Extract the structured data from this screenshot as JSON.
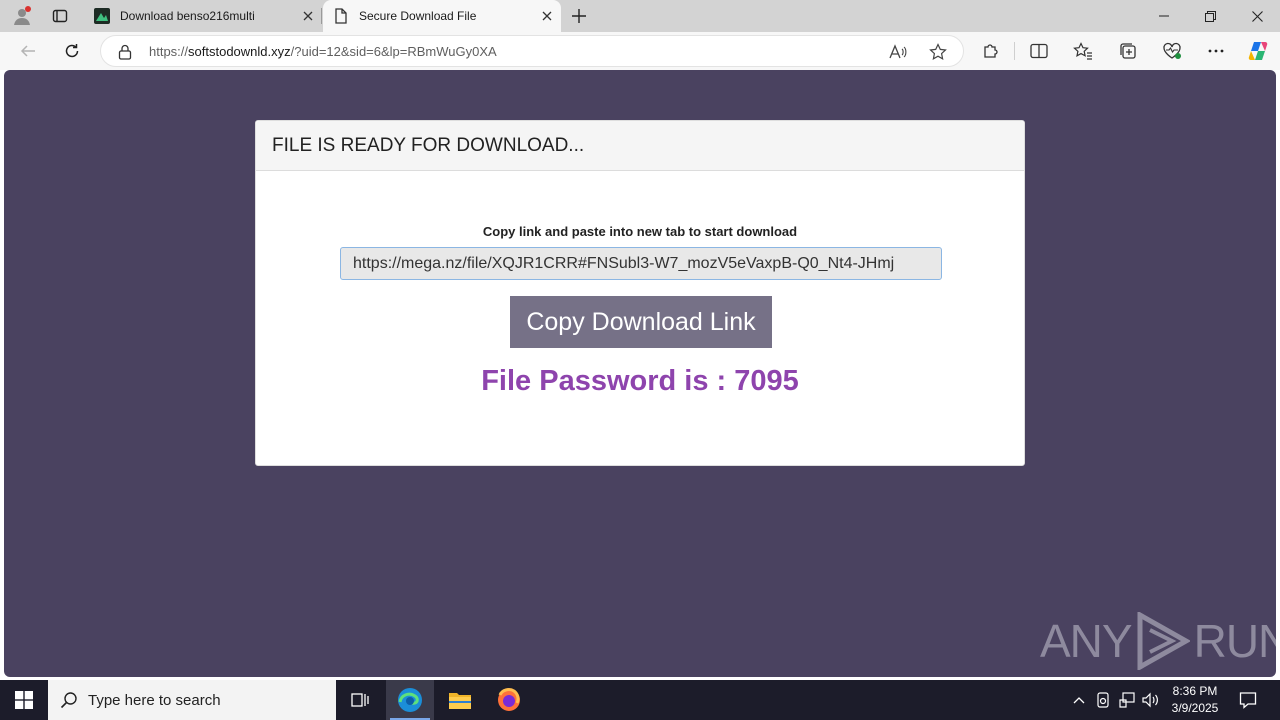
{
  "browser": {
    "tabs": [
      {
        "label": "Download benso216multi"
      },
      {
        "label": "Secure Download File"
      }
    ],
    "address": {
      "host": "softstodownld.xyz",
      "prefix": "https://",
      "path": "/?uid=12&sid=6&lp=RBmWuGy0XA"
    }
  },
  "page": {
    "card_title": "FILE IS READY FOR DOWNLOAD...",
    "instruction": "Copy link and paste into new tab to start download",
    "download_link": "https://mega.nz/file/XQJR1CRR#FNSubl3-W7_mozV5eVaxpB-Q0_Nt4-JHmj",
    "copy_button_label": "Copy Download Link",
    "password_text": "File Password is : 7095",
    "watermark": {
      "left": "ANY",
      "right": "RUN"
    }
  },
  "taskbar": {
    "search_placeholder": "Type here to search",
    "time": "8:36 PM",
    "date": "3/9/2025"
  },
  "colors": {
    "page_background": "#4a4260",
    "button": "#767187",
    "password": "#8e44ad"
  }
}
